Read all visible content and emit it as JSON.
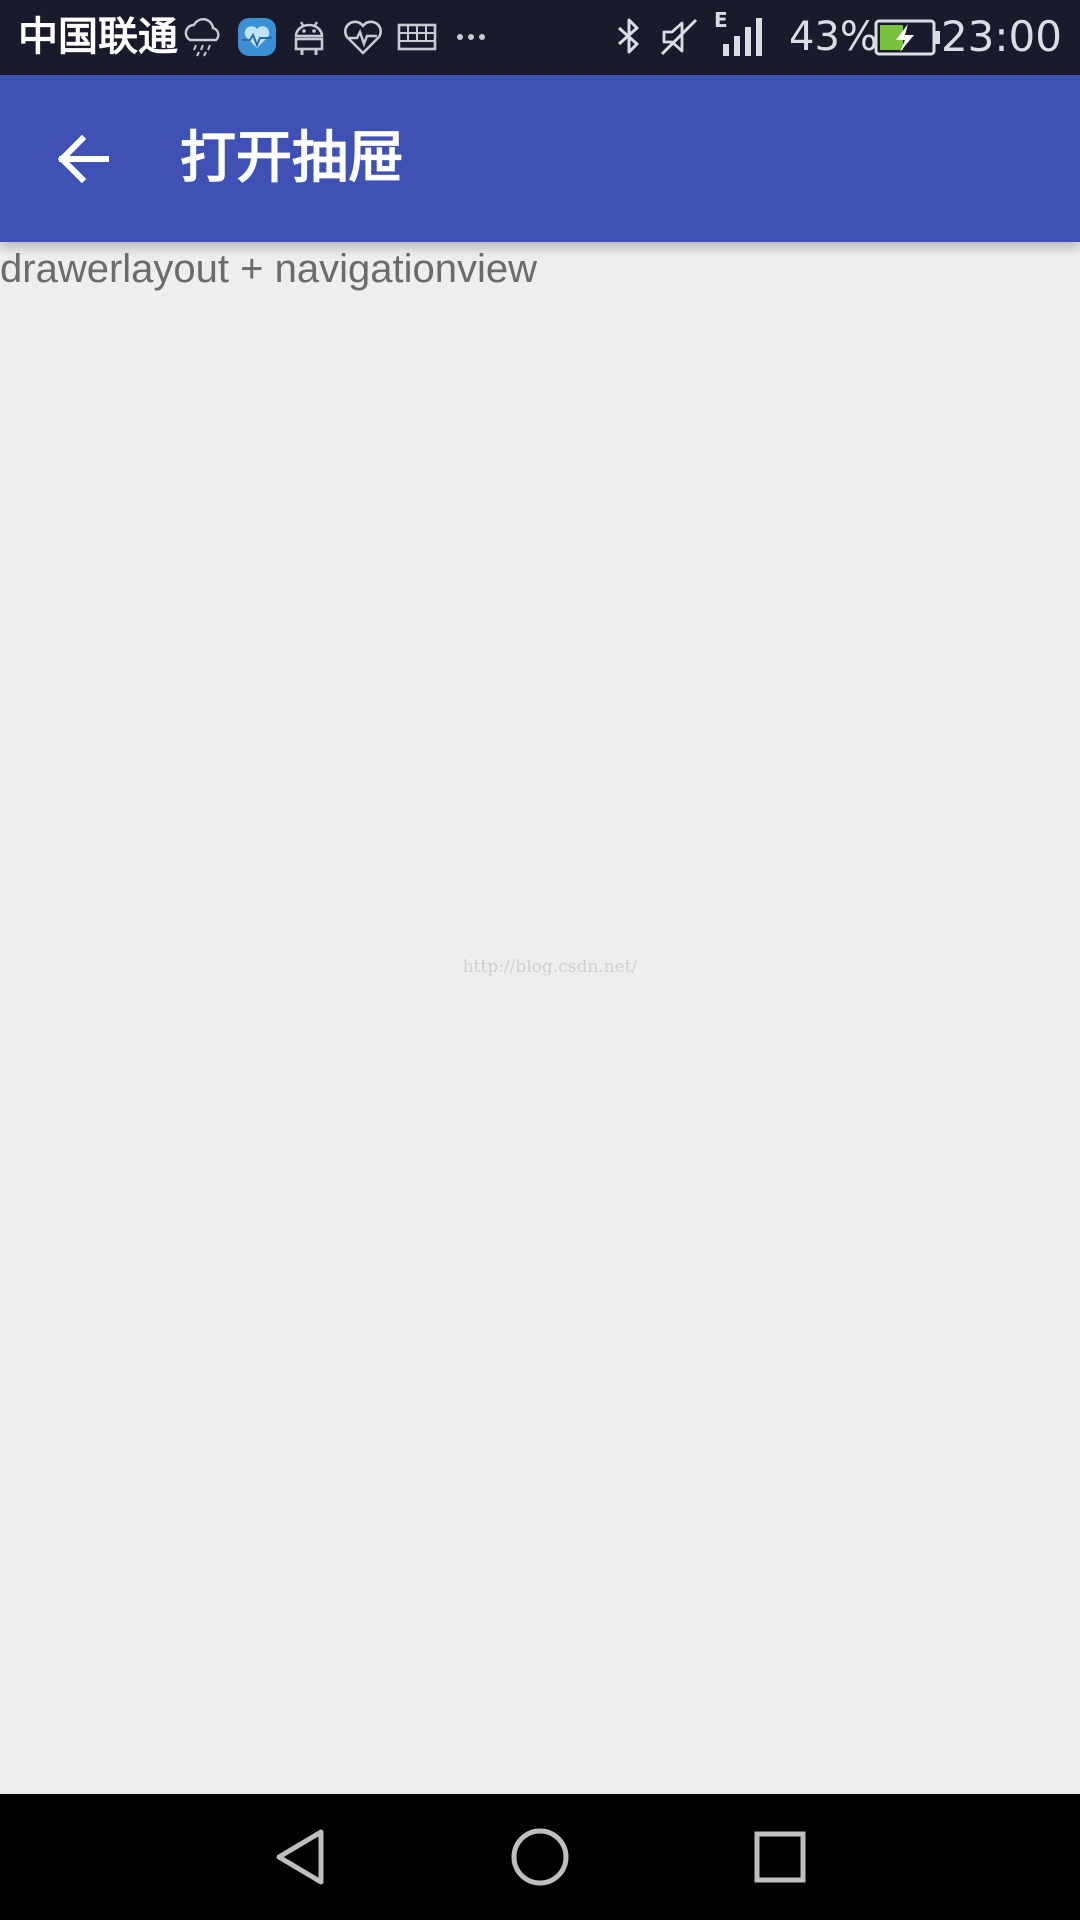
{
  "status_bar": {
    "carrier": "中国联通",
    "battery_percent": "43%",
    "time": "23:00",
    "network_type": "E",
    "icons": [
      "weather-icon",
      "health-app-icon",
      "android-icon",
      "heart-rate-icon",
      "keyboard-icon",
      "more-dots-icon",
      "bluetooth-icon",
      "mute-icon",
      "signal-icon",
      "battery-charging-icon"
    ],
    "colors": {
      "background": "#191b2c",
      "battery_fill": "#7cc242"
    }
  },
  "toolbar": {
    "title": "打开抽屉",
    "back_icon": "arrow-back-icon",
    "background": "#3f51b5"
  },
  "content": {
    "text": "drawerlayout + navigationview",
    "watermark": "http://blog.csdn.net/",
    "background": "#eeeeee"
  },
  "nav_bar": {
    "buttons": [
      "nav-back-icon",
      "nav-home-icon",
      "nav-recents-icon"
    ]
  }
}
